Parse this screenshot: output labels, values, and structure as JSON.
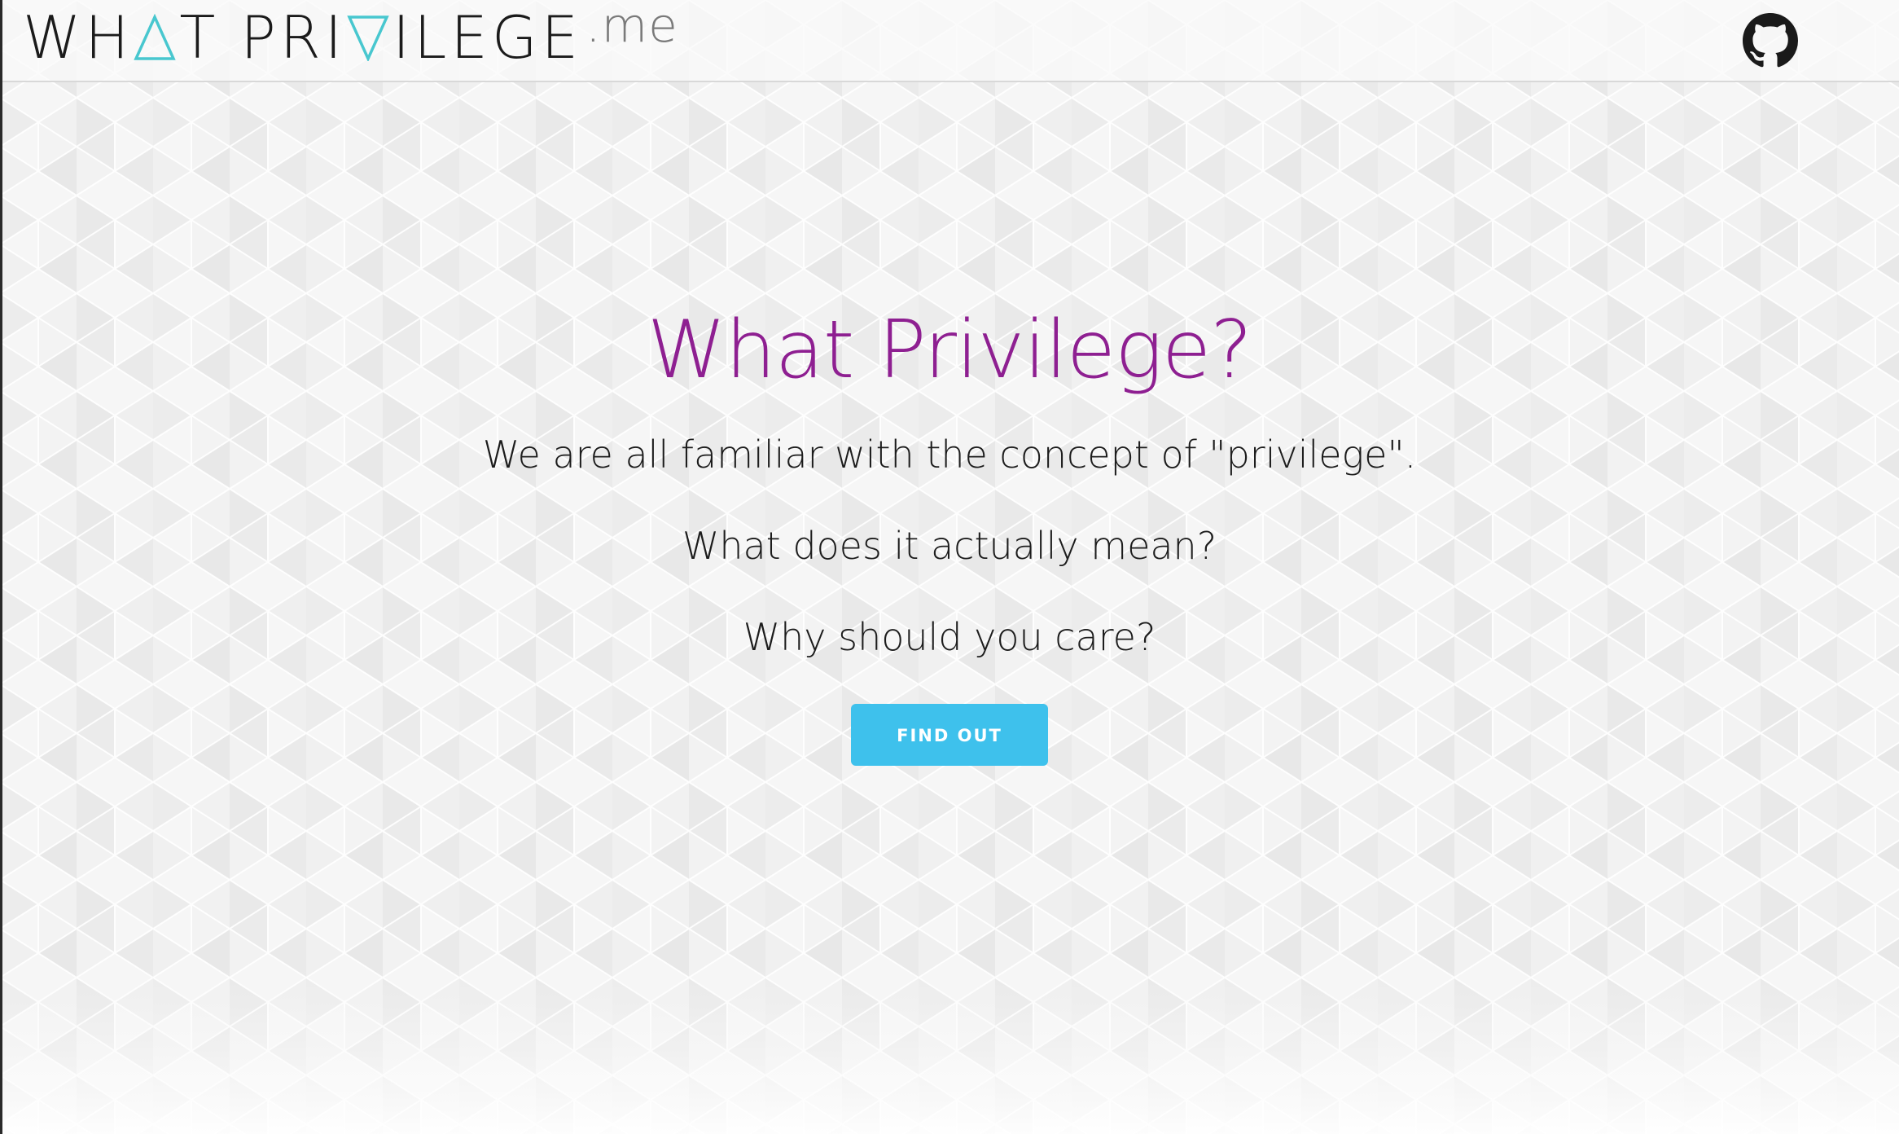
{
  "header": {
    "logo": {
      "word1_pre": "WH",
      "word1_post": "T",
      "word2_pre": "PRI",
      "word2_post": "ILEGE",
      "tld": ".me",
      "triangle_up_icon": "triangle-up-outline",
      "triangle_down_icon": "triangle-down-outline"
    },
    "github_icon": "github-octocat"
  },
  "hero": {
    "title": "What Privilege?",
    "lines": [
      "We are all familiar with the concept of \"privilege\".",
      "What does it actually mean?",
      "Why should you care?"
    ],
    "button_label": "FIND OUT"
  },
  "colors": {
    "title": "#8e1f91",
    "button": "#3ec1ec",
    "logo_accent": "#48c7cf",
    "text": "#1c1c1c",
    "background": "#f6f6f6"
  }
}
